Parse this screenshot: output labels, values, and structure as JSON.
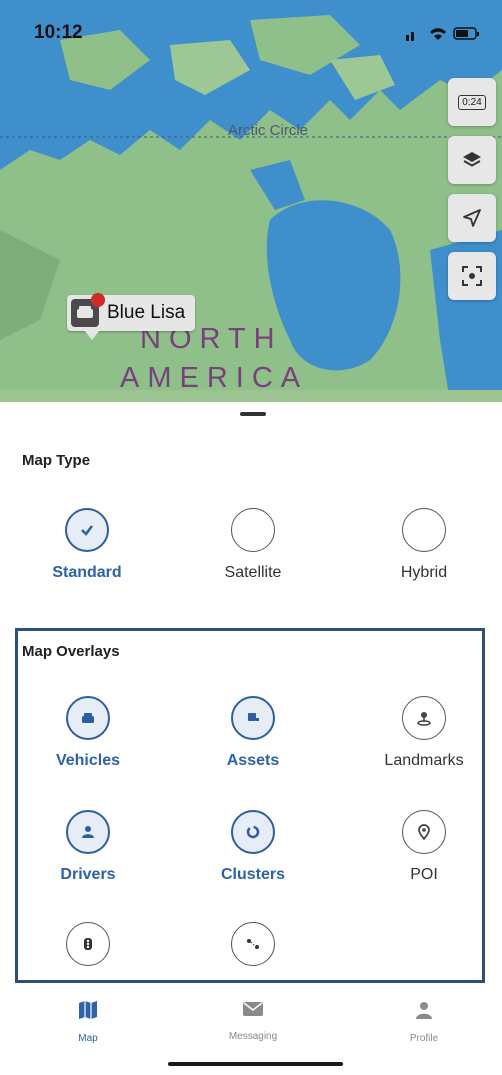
{
  "status_bar": {
    "time": "10:12"
  },
  "map": {
    "arctic_label": "Arctic Circle",
    "continent_line1": "NORTH",
    "continent_line2": "AMERICA",
    "vehicle_label": "Blue Lisa",
    "replay_label": "0:24",
    "controls": [
      "replay-icon",
      "layers-icon",
      "location-arrow-icon",
      "focus-icon"
    ],
    "colors": {
      "water": "#3f8fcc",
      "land": "#8fc08a"
    }
  },
  "map_type": {
    "title": "Map Type",
    "options": [
      {
        "label": "Standard",
        "selected": true
      },
      {
        "label": "Satellite",
        "selected": false
      },
      {
        "label": "Hybrid",
        "selected": false
      }
    ]
  },
  "map_overlays": {
    "title": "Map Overlays",
    "items": [
      {
        "label": "Vehicles",
        "selected": true,
        "icon": "car-icon"
      },
      {
        "label": "Assets",
        "selected": true,
        "icon": "trailer-icon"
      },
      {
        "label": "Landmarks",
        "selected": false,
        "icon": "landmark-pin-icon"
      },
      {
        "label": "Drivers",
        "selected": true,
        "icon": "driver-icon"
      },
      {
        "label": "Clusters",
        "selected": true,
        "icon": "cluster-icon"
      },
      {
        "label": "POI",
        "selected": false,
        "icon": "poi-pin-icon"
      },
      {
        "label": "",
        "selected": false,
        "icon": "traffic-light-icon"
      },
      {
        "label": "",
        "selected": false,
        "icon": "route-icon"
      }
    ]
  },
  "tab_bar": {
    "tabs": [
      {
        "label": "Map",
        "icon": "map-icon",
        "active": true
      },
      {
        "label": "Messaging",
        "icon": "mail-icon",
        "active": false
      },
      {
        "label": "Profile",
        "icon": "person-icon",
        "active": false
      }
    ]
  },
  "accent": "#2d63a8"
}
